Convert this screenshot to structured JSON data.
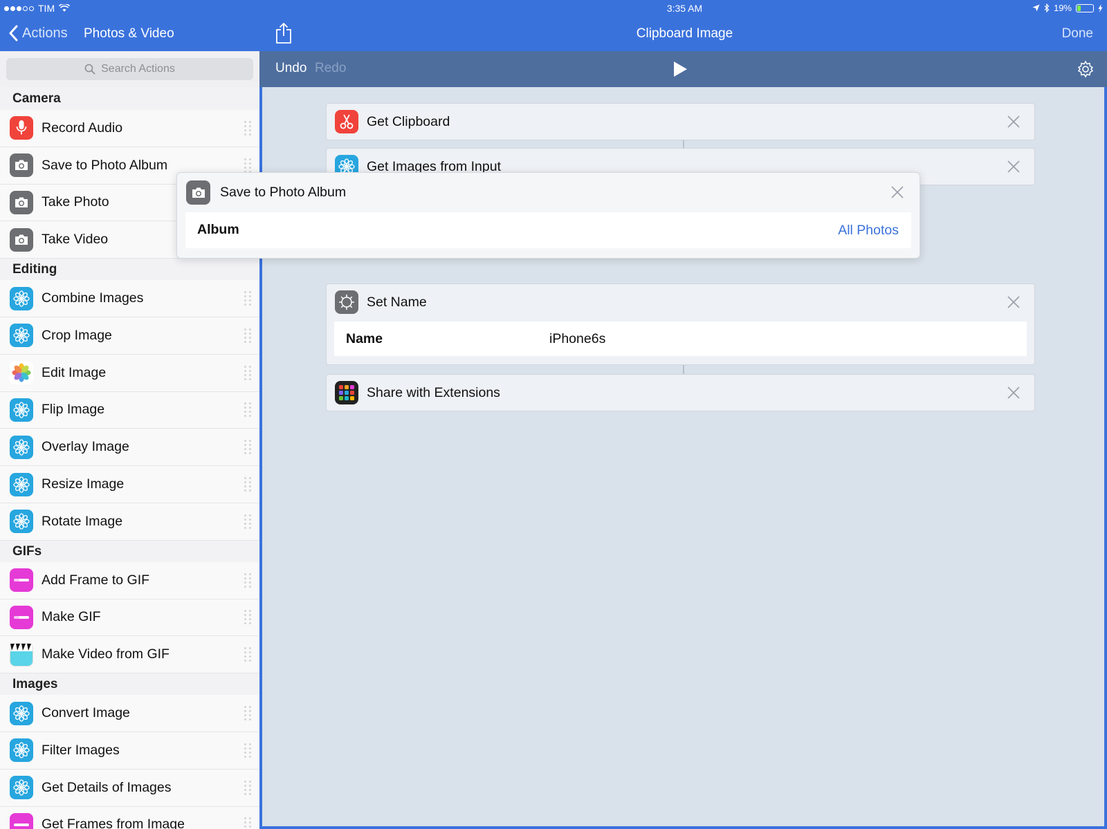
{
  "status": {
    "carrier": "TIM",
    "time": "3:35 AM",
    "battery": "19%"
  },
  "sidebar": {
    "back_label": "Actions",
    "title": "Photos & Video",
    "search_placeholder": "Search Actions",
    "sections": [
      {
        "title": "Camera",
        "items": [
          "Record Audio",
          "Save to Photo Album",
          "Take Photo",
          "Take Video"
        ]
      },
      {
        "title": "Editing",
        "items": [
          "Combine Images",
          "Crop Image",
          "Edit Image",
          "Flip Image",
          "Overlay Image",
          "Resize Image",
          "Rotate Image"
        ]
      },
      {
        "title": "GIFs",
        "items": [
          "Add Frame to GIF",
          "Make GIF",
          "Make Video from GIF"
        ]
      },
      {
        "title": "Images",
        "items": [
          "Convert Image",
          "Filter Images",
          "Get Details of Images",
          "Get Frames from Image"
        ]
      }
    ]
  },
  "header": {
    "workflow_title": "Clipboard Image",
    "done_label": "Done",
    "undo_label": "Undo",
    "redo_label": "Redo"
  },
  "workflow": {
    "get_clipboard": "Get Clipboard",
    "get_images": "Get Images from Input",
    "set_name": {
      "title": "Set Name",
      "param_label": "Name",
      "param_value": "iPhone6s"
    },
    "share": "Share with Extensions"
  },
  "popover": {
    "title": "Save to Photo Album",
    "param_label": "Album",
    "param_value": "All Photos"
  },
  "colors": {
    "accent": "#3a72dc",
    "toolbar": "#4e6e9e",
    "canvas": "#d9e1ea"
  }
}
